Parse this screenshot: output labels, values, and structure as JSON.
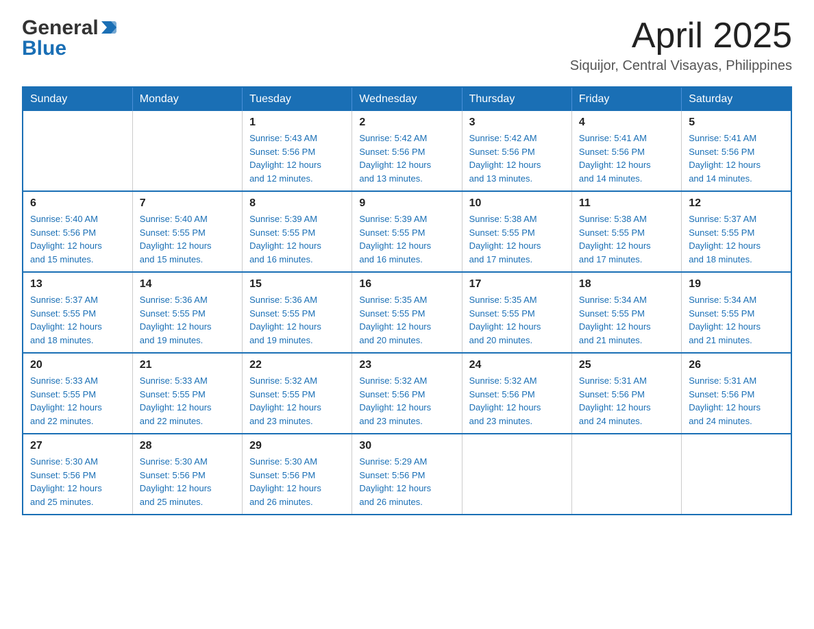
{
  "header": {
    "title": "April 2025",
    "subtitle": "Siquijor, Central Visayas, Philippines",
    "logo_general": "General",
    "logo_blue": "Blue"
  },
  "calendar": {
    "days_of_week": [
      "Sunday",
      "Monday",
      "Tuesday",
      "Wednesday",
      "Thursday",
      "Friday",
      "Saturday"
    ],
    "weeks": [
      [
        {
          "day": "",
          "info": ""
        },
        {
          "day": "",
          "info": ""
        },
        {
          "day": "1",
          "info": "Sunrise: 5:43 AM\nSunset: 5:56 PM\nDaylight: 12 hours\nand 12 minutes."
        },
        {
          "day": "2",
          "info": "Sunrise: 5:42 AM\nSunset: 5:56 PM\nDaylight: 12 hours\nand 13 minutes."
        },
        {
          "day": "3",
          "info": "Sunrise: 5:42 AM\nSunset: 5:56 PM\nDaylight: 12 hours\nand 13 minutes."
        },
        {
          "day": "4",
          "info": "Sunrise: 5:41 AM\nSunset: 5:56 PM\nDaylight: 12 hours\nand 14 minutes."
        },
        {
          "day": "5",
          "info": "Sunrise: 5:41 AM\nSunset: 5:56 PM\nDaylight: 12 hours\nand 14 minutes."
        }
      ],
      [
        {
          "day": "6",
          "info": "Sunrise: 5:40 AM\nSunset: 5:56 PM\nDaylight: 12 hours\nand 15 minutes."
        },
        {
          "day": "7",
          "info": "Sunrise: 5:40 AM\nSunset: 5:55 PM\nDaylight: 12 hours\nand 15 minutes."
        },
        {
          "day": "8",
          "info": "Sunrise: 5:39 AM\nSunset: 5:55 PM\nDaylight: 12 hours\nand 16 minutes."
        },
        {
          "day": "9",
          "info": "Sunrise: 5:39 AM\nSunset: 5:55 PM\nDaylight: 12 hours\nand 16 minutes."
        },
        {
          "day": "10",
          "info": "Sunrise: 5:38 AM\nSunset: 5:55 PM\nDaylight: 12 hours\nand 17 minutes."
        },
        {
          "day": "11",
          "info": "Sunrise: 5:38 AM\nSunset: 5:55 PM\nDaylight: 12 hours\nand 17 minutes."
        },
        {
          "day": "12",
          "info": "Sunrise: 5:37 AM\nSunset: 5:55 PM\nDaylight: 12 hours\nand 18 minutes."
        }
      ],
      [
        {
          "day": "13",
          "info": "Sunrise: 5:37 AM\nSunset: 5:55 PM\nDaylight: 12 hours\nand 18 minutes."
        },
        {
          "day": "14",
          "info": "Sunrise: 5:36 AM\nSunset: 5:55 PM\nDaylight: 12 hours\nand 19 minutes."
        },
        {
          "day": "15",
          "info": "Sunrise: 5:36 AM\nSunset: 5:55 PM\nDaylight: 12 hours\nand 19 minutes."
        },
        {
          "day": "16",
          "info": "Sunrise: 5:35 AM\nSunset: 5:55 PM\nDaylight: 12 hours\nand 20 minutes."
        },
        {
          "day": "17",
          "info": "Sunrise: 5:35 AM\nSunset: 5:55 PM\nDaylight: 12 hours\nand 20 minutes."
        },
        {
          "day": "18",
          "info": "Sunrise: 5:34 AM\nSunset: 5:55 PM\nDaylight: 12 hours\nand 21 minutes."
        },
        {
          "day": "19",
          "info": "Sunrise: 5:34 AM\nSunset: 5:55 PM\nDaylight: 12 hours\nand 21 minutes."
        }
      ],
      [
        {
          "day": "20",
          "info": "Sunrise: 5:33 AM\nSunset: 5:55 PM\nDaylight: 12 hours\nand 22 minutes."
        },
        {
          "day": "21",
          "info": "Sunrise: 5:33 AM\nSunset: 5:55 PM\nDaylight: 12 hours\nand 22 minutes."
        },
        {
          "day": "22",
          "info": "Sunrise: 5:32 AM\nSunset: 5:55 PM\nDaylight: 12 hours\nand 23 minutes."
        },
        {
          "day": "23",
          "info": "Sunrise: 5:32 AM\nSunset: 5:56 PM\nDaylight: 12 hours\nand 23 minutes."
        },
        {
          "day": "24",
          "info": "Sunrise: 5:32 AM\nSunset: 5:56 PM\nDaylight: 12 hours\nand 23 minutes."
        },
        {
          "day": "25",
          "info": "Sunrise: 5:31 AM\nSunset: 5:56 PM\nDaylight: 12 hours\nand 24 minutes."
        },
        {
          "day": "26",
          "info": "Sunrise: 5:31 AM\nSunset: 5:56 PM\nDaylight: 12 hours\nand 24 minutes."
        }
      ],
      [
        {
          "day": "27",
          "info": "Sunrise: 5:30 AM\nSunset: 5:56 PM\nDaylight: 12 hours\nand 25 minutes."
        },
        {
          "day": "28",
          "info": "Sunrise: 5:30 AM\nSunset: 5:56 PM\nDaylight: 12 hours\nand 25 minutes."
        },
        {
          "day": "29",
          "info": "Sunrise: 5:30 AM\nSunset: 5:56 PM\nDaylight: 12 hours\nand 26 minutes."
        },
        {
          "day": "30",
          "info": "Sunrise: 5:29 AM\nSunset: 5:56 PM\nDaylight: 12 hours\nand 26 minutes."
        },
        {
          "day": "",
          "info": ""
        },
        {
          "day": "",
          "info": ""
        },
        {
          "day": "",
          "info": ""
        }
      ]
    ]
  }
}
